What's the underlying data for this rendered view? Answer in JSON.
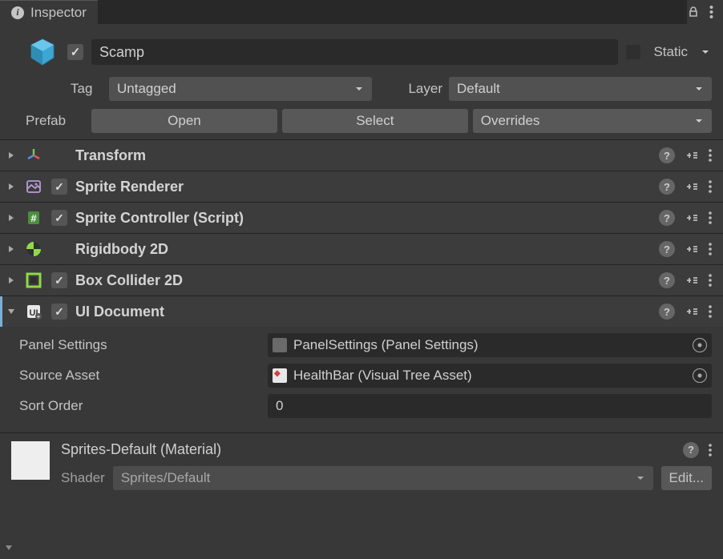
{
  "tab": {
    "title": "Inspector"
  },
  "header": {
    "object_name": "Scamp",
    "static_label": "Static",
    "tag_label": "Tag",
    "tag_value": "Untagged",
    "layer_label": "Layer",
    "layer_value": "Default",
    "prefab_label": "Prefab",
    "open_btn": "Open",
    "select_btn": "Select",
    "overrides_btn": "Overrides"
  },
  "components": [
    {
      "name": "Transform",
      "has_checkbox": false,
      "expanded": false
    },
    {
      "name": "Sprite Renderer",
      "has_checkbox": true,
      "expanded": false
    },
    {
      "name": "Sprite Controller (Script)",
      "has_checkbox": true,
      "expanded": false
    },
    {
      "name": "Rigidbody 2D",
      "has_checkbox": false,
      "expanded": false
    },
    {
      "name": "Box Collider 2D",
      "has_checkbox": true,
      "expanded": false
    },
    {
      "name": "UI Document",
      "has_checkbox": true,
      "expanded": true
    }
  ],
  "ui_document": {
    "panel_settings_label": "Panel Settings",
    "panel_settings_value": "PanelSettings (Panel Settings)",
    "source_asset_label": "Source Asset",
    "source_asset_value": "HealthBar (Visual Tree Asset)",
    "sort_order_label": "Sort Order",
    "sort_order_value": "0"
  },
  "material": {
    "name": "Sprites-Default (Material)",
    "shader_label": "Shader",
    "shader_value": "Sprites/Default",
    "edit_btn": "Edit..."
  }
}
